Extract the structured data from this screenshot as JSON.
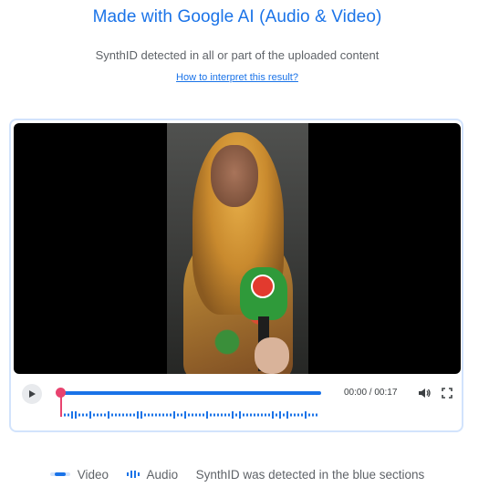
{
  "header": {
    "title": "Made with Google AI (Audio & Video)",
    "subtitle": "SynthID detected in all or part of the uploaded content",
    "help_link": "How to interpret this result?"
  },
  "player": {
    "time": "00:00 / 00:17",
    "progress_fraction": 0,
    "icons": {
      "play": "play-icon",
      "volume": "volume-icon",
      "fullscreen": "fullscreen-icon"
    }
  },
  "legend": {
    "video_label": "Video",
    "audio_label": "Audio",
    "note": "SynthID was detected in the blue sections"
  },
  "colors": {
    "accent": "#1a73e8",
    "playhead": "#e8436f"
  }
}
